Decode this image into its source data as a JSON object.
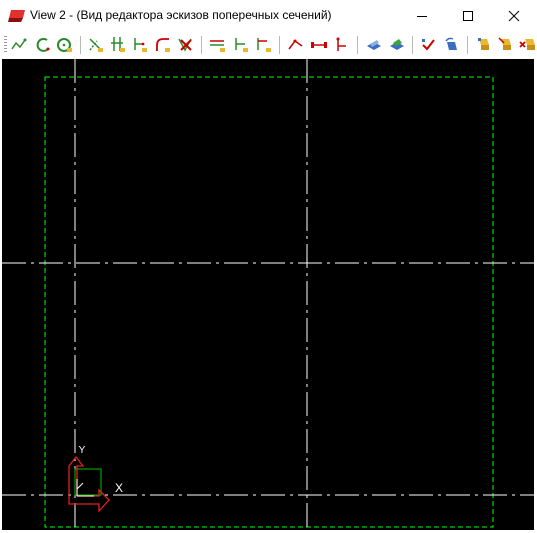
{
  "window": {
    "title": "View 2 - (Вид редактора эскизов поперечных сечений)",
    "controls": [
      "minimize",
      "maximize",
      "close"
    ]
  },
  "toolbar": {
    "icons": [
      "polyline-sketch-icon",
      "arc-sketch-icon",
      "circle-sketch-icon",
      "trim-icon",
      "extend-icon",
      "offset-icon",
      "fillet-icon",
      "delete-segment-icon",
      "parallel-constraint-icon",
      "perpendicular-constraint-icon",
      "angle-constraint-icon",
      "dimension-icon",
      "horizontal-dimension-icon",
      "vertical-dimension-icon",
      "profile-icon",
      "profile-fill-icon",
      "check-sketch-icon",
      "update-icon",
      "shape-tool-icon",
      "shape-edit-icon",
      "shape-delete-icon"
    ]
  },
  "canvas": {
    "background": "#000000",
    "axis_color": "#ffffff",
    "boundary_color": "#00ff00",
    "ucs_x_label": "X",
    "ucs_y_label": "Y"
  }
}
